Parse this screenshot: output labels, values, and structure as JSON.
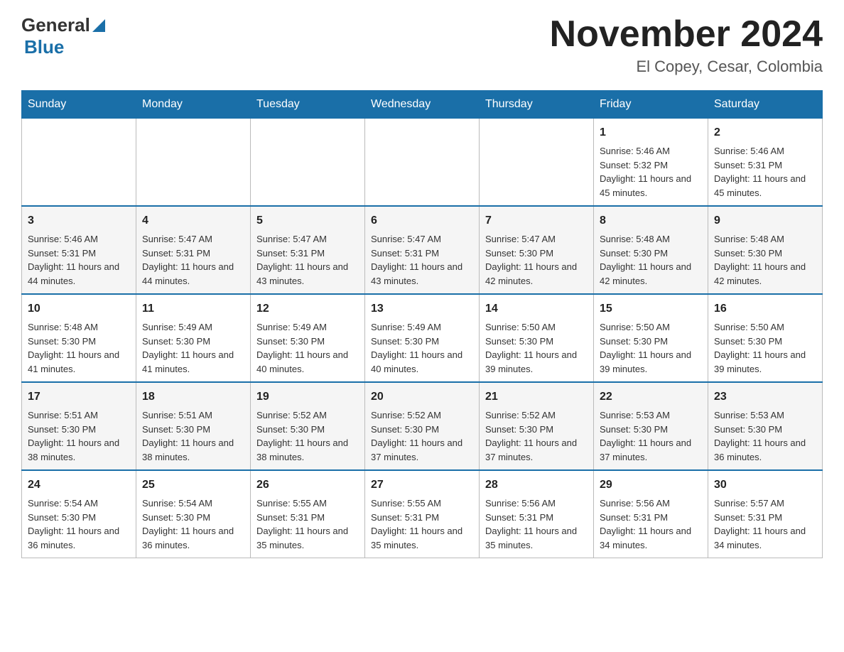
{
  "header": {
    "logo_general": "General",
    "logo_blue": "Blue",
    "month_title": "November 2024",
    "location": "El Copey, Cesar, Colombia"
  },
  "days_of_week": [
    "Sunday",
    "Monday",
    "Tuesday",
    "Wednesday",
    "Thursday",
    "Friday",
    "Saturday"
  ],
  "weeks": [
    {
      "days": [
        {
          "number": "",
          "info": ""
        },
        {
          "number": "",
          "info": ""
        },
        {
          "number": "",
          "info": ""
        },
        {
          "number": "",
          "info": ""
        },
        {
          "number": "",
          "info": ""
        },
        {
          "number": "1",
          "info": "Sunrise: 5:46 AM\nSunset: 5:32 PM\nDaylight: 11 hours and 45 minutes."
        },
        {
          "number": "2",
          "info": "Sunrise: 5:46 AM\nSunset: 5:31 PM\nDaylight: 11 hours and 45 minutes."
        }
      ]
    },
    {
      "days": [
        {
          "number": "3",
          "info": "Sunrise: 5:46 AM\nSunset: 5:31 PM\nDaylight: 11 hours and 44 minutes."
        },
        {
          "number": "4",
          "info": "Sunrise: 5:47 AM\nSunset: 5:31 PM\nDaylight: 11 hours and 44 minutes."
        },
        {
          "number": "5",
          "info": "Sunrise: 5:47 AM\nSunset: 5:31 PM\nDaylight: 11 hours and 43 minutes."
        },
        {
          "number": "6",
          "info": "Sunrise: 5:47 AM\nSunset: 5:31 PM\nDaylight: 11 hours and 43 minutes."
        },
        {
          "number": "7",
          "info": "Sunrise: 5:47 AM\nSunset: 5:30 PM\nDaylight: 11 hours and 42 minutes."
        },
        {
          "number": "8",
          "info": "Sunrise: 5:48 AM\nSunset: 5:30 PM\nDaylight: 11 hours and 42 minutes."
        },
        {
          "number": "9",
          "info": "Sunrise: 5:48 AM\nSunset: 5:30 PM\nDaylight: 11 hours and 42 minutes."
        }
      ]
    },
    {
      "days": [
        {
          "number": "10",
          "info": "Sunrise: 5:48 AM\nSunset: 5:30 PM\nDaylight: 11 hours and 41 minutes."
        },
        {
          "number": "11",
          "info": "Sunrise: 5:49 AM\nSunset: 5:30 PM\nDaylight: 11 hours and 41 minutes."
        },
        {
          "number": "12",
          "info": "Sunrise: 5:49 AM\nSunset: 5:30 PM\nDaylight: 11 hours and 40 minutes."
        },
        {
          "number": "13",
          "info": "Sunrise: 5:49 AM\nSunset: 5:30 PM\nDaylight: 11 hours and 40 minutes."
        },
        {
          "number": "14",
          "info": "Sunrise: 5:50 AM\nSunset: 5:30 PM\nDaylight: 11 hours and 39 minutes."
        },
        {
          "number": "15",
          "info": "Sunrise: 5:50 AM\nSunset: 5:30 PM\nDaylight: 11 hours and 39 minutes."
        },
        {
          "number": "16",
          "info": "Sunrise: 5:50 AM\nSunset: 5:30 PM\nDaylight: 11 hours and 39 minutes."
        }
      ]
    },
    {
      "days": [
        {
          "number": "17",
          "info": "Sunrise: 5:51 AM\nSunset: 5:30 PM\nDaylight: 11 hours and 38 minutes."
        },
        {
          "number": "18",
          "info": "Sunrise: 5:51 AM\nSunset: 5:30 PM\nDaylight: 11 hours and 38 minutes."
        },
        {
          "number": "19",
          "info": "Sunrise: 5:52 AM\nSunset: 5:30 PM\nDaylight: 11 hours and 38 minutes."
        },
        {
          "number": "20",
          "info": "Sunrise: 5:52 AM\nSunset: 5:30 PM\nDaylight: 11 hours and 37 minutes."
        },
        {
          "number": "21",
          "info": "Sunrise: 5:52 AM\nSunset: 5:30 PM\nDaylight: 11 hours and 37 minutes."
        },
        {
          "number": "22",
          "info": "Sunrise: 5:53 AM\nSunset: 5:30 PM\nDaylight: 11 hours and 37 minutes."
        },
        {
          "number": "23",
          "info": "Sunrise: 5:53 AM\nSunset: 5:30 PM\nDaylight: 11 hours and 36 minutes."
        }
      ]
    },
    {
      "days": [
        {
          "number": "24",
          "info": "Sunrise: 5:54 AM\nSunset: 5:30 PM\nDaylight: 11 hours and 36 minutes."
        },
        {
          "number": "25",
          "info": "Sunrise: 5:54 AM\nSunset: 5:30 PM\nDaylight: 11 hours and 36 minutes."
        },
        {
          "number": "26",
          "info": "Sunrise: 5:55 AM\nSunset: 5:31 PM\nDaylight: 11 hours and 35 minutes."
        },
        {
          "number": "27",
          "info": "Sunrise: 5:55 AM\nSunset: 5:31 PM\nDaylight: 11 hours and 35 minutes."
        },
        {
          "number": "28",
          "info": "Sunrise: 5:56 AM\nSunset: 5:31 PM\nDaylight: 11 hours and 35 minutes."
        },
        {
          "number": "29",
          "info": "Sunrise: 5:56 AM\nSunset: 5:31 PM\nDaylight: 11 hours and 34 minutes."
        },
        {
          "number": "30",
          "info": "Sunrise: 5:57 AM\nSunset: 5:31 PM\nDaylight: 11 hours and 34 minutes."
        }
      ]
    }
  ]
}
